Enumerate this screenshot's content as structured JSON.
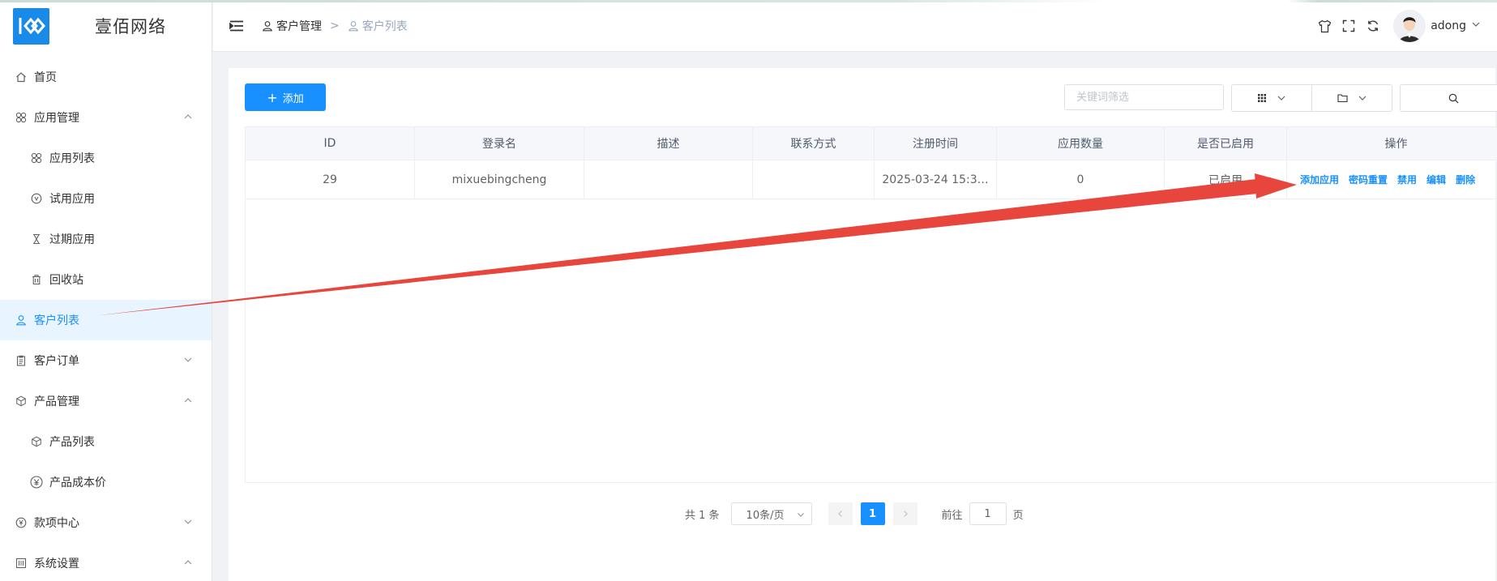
{
  "app": {
    "brand_name": "壹佰网络",
    "user": {
      "name": "adong"
    }
  },
  "sidebar": {
    "items": [
      {
        "label": "首页",
        "icon": "home-icon"
      },
      {
        "label": "应用管理",
        "icon": "apps-icon",
        "expanded": true
      },
      {
        "label": "应用列表",
        "icon": "apps-icon",
        "sub": true
      },
      {
        "label": "试用应用",
        "icon": "trial-icon",
        "sub": true
      },
      {
        "label": "过期应用",
        "icon": "hourglass-icon",
        "sub": true
      },
      {
        "label": "回收站",
        "icon": "trash-icon",
        "sub": true
      },
      {
        "label": "客户列表",
        "icon": "user-icon",
        "active": true
      },
      {
        "label": "客户订单",
        "icon": "clipboard-icon",
        "expanded": false
      },
      {
        "label": "产品管理",
        "icon": "cube-icon",
        "expanded": true
      },
      {
        "label": "产品列表",
        "icon": "cube-icon",
        "sub": true
      },
      {
        "label": "产品成本价",
        "icon": "yuan-icon",
        "sub": true
      },
      {
        "label": "款项中心",
        "icon": "money-icon",
        "expanded": false
      },
      {
        "label": "系统设置",
        "icon": "settings-icon",
        "expanded": true
      }
    ]
  },
  "breadcrumb": {
    "items": [
      "客户管理",
      "客户列表"
    ],
    "separator": ">"
  },
  "toolbar": {
    "add_label": "添加",
    "search_placeholder": "关键词筛选"
  },
  "table": {
    "columns": [
      "ID",
      "登录名",
      "描述",
      "联系方式",
      "注册时间",
      "应用数量",
      "是否已启用",
      "操作"
    ],
    "rows": [
      {
        "id": "29",
        "login": "mixuebingcheng",
        "desc": "",
        "contact": "",
        "registered": "2025-03-24 15:3…",
        "app_count": "0",
        "enabled": "已启用",
        "actions": [
          "添加应用",
          "密码重置",
          "禁用",
          "编辑",
          "删除"
        ]
      }
    ]
  },
  "pagination": {
    "total_text": "共 1 条",
    "page_size": "10条/页",
    "current_page": "1",
    "goto_label": "前往",
    "goto_value": "1",
    "page_suffix": "页"
  },
  "colors": {
    "primary": "#1890ff",
    "logo_bg": "#1a8ae8",
    "annotation_arrow": "#e8453c"
  }
}
